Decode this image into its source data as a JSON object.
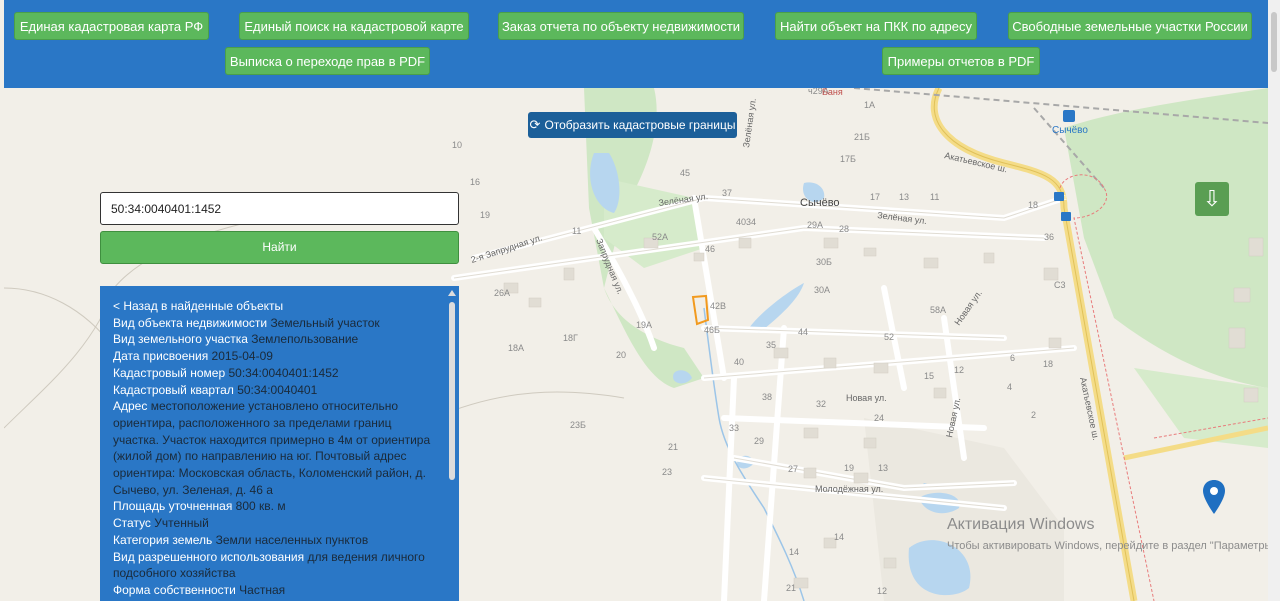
{
  "topbar": {
    "buttons": [
      "Единая кадастровая карта РФ",
      "Единый поиск на кадастровой карте",
      "Заказ отчета по объекту недвижимости",
      "Найти объект на ПКК по адресу",
      "Свободные земельные участки России",
      "Выписка о переходе прав в PDF",
      "Примеры отчетов в PDF"
    ]
  },
  "map_toolbar": {
    "cadastral_button": "Отобразить кадастровые границы"
  },
  "search": {
    "value": "50:34:0040401:1452",
    "button": "Найти"
  },
  "info": {
    "back_link": "< Назад в найденные объекты",
    "rows": [
      {
        "key": "Вид объекта недвижимости",
        "value": "Земельный участок"
      },
      {
        "key": "Вид земельного участка",
        "value": "Землепользование"
      },
      {
        "key": "Дата присвоения",
        "value": "2015-04-09"
      },
      {
        "key": "Кадастровый номер",
        "value": "50:34:0040401:1452"
      },
      {
        "key": "Кадастровый квартал",
        "value": "50:34:0040401"
      },
      {
        "key": "Адрес",
        "value": "местоположение установлено относительно ориентира, расположенного за пределами границ участка. Участок находится примерно в 4м от ориентира (жилой дом) по направлению на юг. Почтовый адрес ориентира: Московская область, Коломенский район, д. Сычево, ул. Зеленая, д. 46 а"
      },
      {
        "key": "Площадь уточненная",
        "value": "800 кв. м"
      },
      {
        "key": "Статус",
        "value": "Учтенный"
      },
      {
        "key": "Категория земель",
        "value": "Земли населенных пунктов"
      },
      {
        "key": "Вид разрешенного использования",
        "value": "для ведения личного подсобного хозяйства"
      },
      {
        "key": "Форма собственности",
        "value": "Частная"
      }
    ]
  },
  "map": {
    "village": "Сычёво",
    "station": "Сычёво",
    "banya": "Баня",
    "streets": [
      "Зелёная ул.",
      "Зелёная ул.",
      "2-я Запрудная ул.",
      "Запрудная ул.",
      "Акатьевское ш.",
      "Акатьевское ш.",
      "Новая ул.",
      "Новая ул.",
      "Новая ул.",
      "Молодёжная ул.",
      "Зелёная ул."
    ],
    "house_numbers": [
      "10",
      "16",
      "19",
      "11",
      "26А",
      "18А",
      "18Г",
      "19А",
      "20",
      "23Б",
      "21",
      "23",
      "45",
      "37",
      "40",
      "34",
      "52А",
      "46",
      "42В",
      "46Б",
      "29А",
      "28",
      "30Б",
      "30А",
      "44",
      "52",
      "58А",
      "35",
      "40",
      "38",
      "32",
      "33",
      "29",
      "27",
      "19",
      "13",
      "15",
      "12",
      "6",
      "4",
      "2",
      "18",
      "21Б",
      "17Б",
      "1А",
      "17",
      "13",
      "11",
      "18",
      "36",
      "С3",
      "24",
      "14",
      "14",
      "12",
      "ч29А",
      "С1"
    ],
    "download_icon": "download-arrow-icon",
    "pin_icon": "location-pin-icon",
    "accent_colors": {
      "topbar": "#2a77c6",
      "button": "#5cb85c",
      "selected_parcel": "#f29a1e"
    }
  },
  "watermark": {
    "title": "Активация Windows",
    "subtitle": "Чтобы активировать Windows, перейдите в раздел \"Параметры\"."
  }
}
